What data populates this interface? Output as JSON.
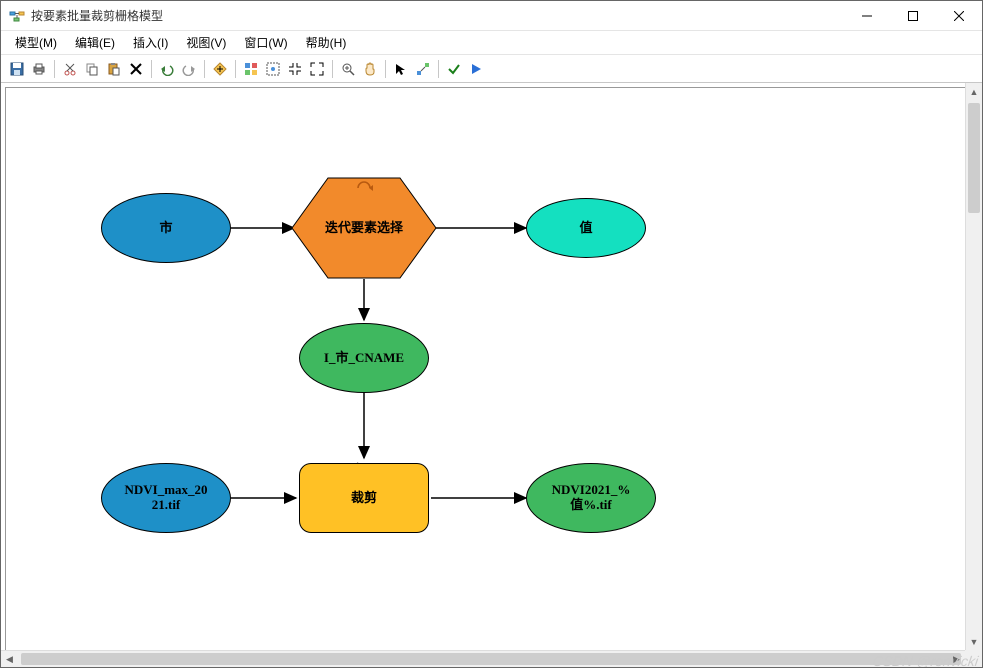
{
  "window": {
    "title": "按要素批量裁剪栅格模型"
  },
  "menus": {
    "model": "模型(M)",
    "edit": "编辑(E)",
    "insert": "插入(I)",
    "view": "视图(V)",
    "window": "窗口(W)",
    "help": "帮助(H)"
  },
  "tools": {
    "save": "save",
    "print": "print",
    "cut": "cut",
    "copy": "copy",
    "paste": "paste",
    "delete": "delete",
    "undo": "undo",
    "redo": "redo",
    "add_data": "add-data",
    "auto_layout": "auto-layout",
    "full_extent": "full-extent",
    "fixed_zoom_in": "fixed-zoom-in",
    "fixed_zoom_out": "fixed-zoom-out",
    "zoom_in": "zoom-in",
    "pan": "pan",
    "select": "select",
    "connect": "connect",
    "validate": "validate",
    "run": "run"
  },
  "nodes": {
    "input1": "市",
    "iterator": "迭代要素选择",
    "value": "值",
    "selected": "I_市_CNAME",
    "input2": "NDVI_max_20\n21.tif",
    "clip": "裁剪",
    "output": "NDVI2021_%\n值%.tif"
  },
  "watermark": "CSDN @ronvicki",
  "colors": {
    "blue": "#1e90c8",
    "orange_hex": "#f28a2b",
    "cyan": "#14e0c0",
    "green": "#3fb85f",
    "yellow": "#ffc125"
  }
}
